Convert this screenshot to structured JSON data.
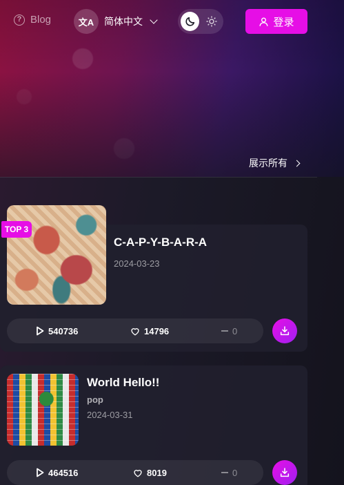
{
  "header": {
    "blog_label": "Blog",
    "language": "简体中文",
    "language_icon_glyph": "文A",
    "login_label": "登录"
  },
  "section": {
    "show_all_label": "展示所有"
  },
  "songs": [
    {
      "rank_badge": "TOP 3",
      "title": "C-A-P-Y-B-A-R-A",
      "date": "2024-03-23",
      "plays": "540736",
      "likes": "14796",
      "comments": "0"
    },
    {
      "title": "World Hello!!",
      "genre": "pop",
      "date": "2024-03-31",
      "plays": "464516",
      "likes": "8019",
      "comments": "0"
    }
  ],
  "colors": {
    "accent": "#e60ee6",
    "card_bg": "#211f2e"
  }
}
